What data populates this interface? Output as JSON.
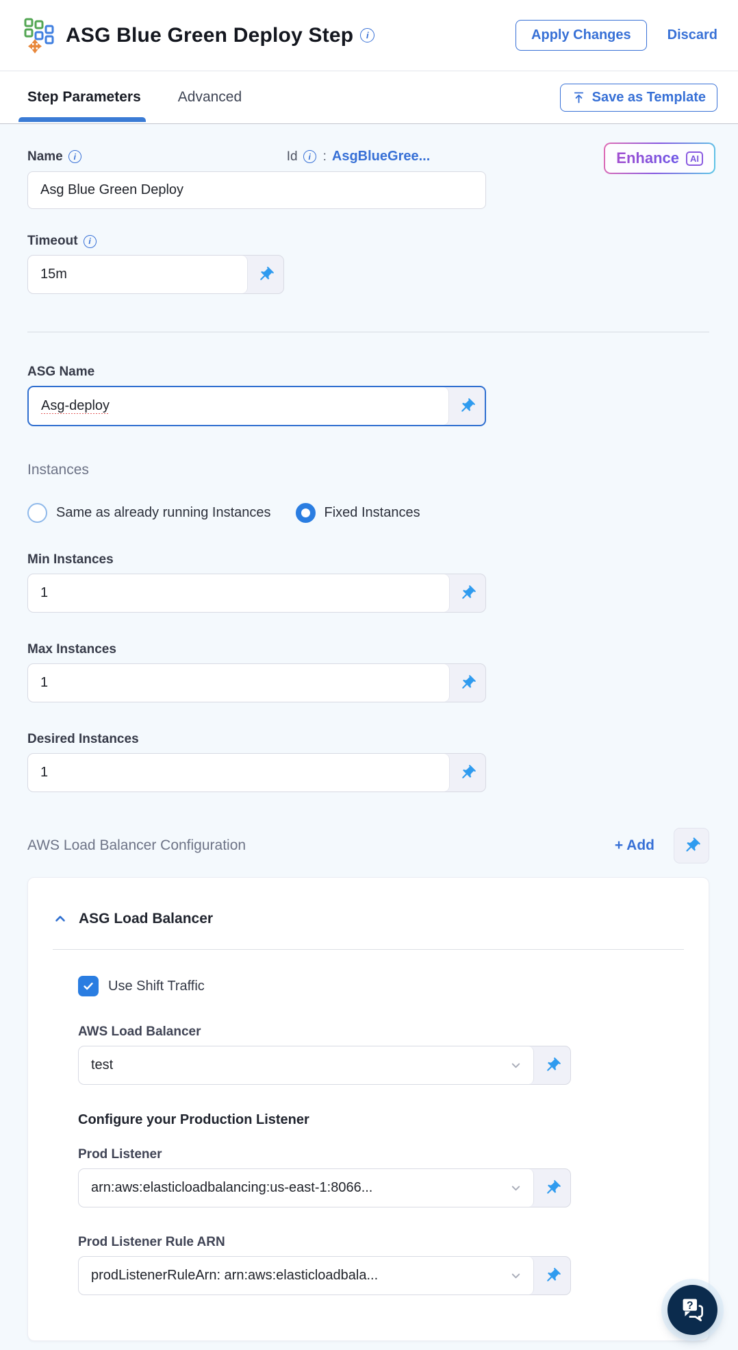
{
  "header": {
    "title": "ASG Blue Green Deploy Step",
    "apply_label": "Apply Changes",
    "discard_label": "Discard"
  },
  "tabs": {
    "step_parameters": "Step Parameters",
    "advanced": "Advanced",
    "save_as_template": "Save as Template"
  },
  "enhance": {
    "label": "Enhance",
    "badge": "AI"
  },
  "form": {
    "name": {
      "label": "Name",
      "value": "Asg Blue Green Deploy"
    },
    "id": {
      "label": "Id",
      "colon": ":",
      "value": "AsgBlueGree..."
    },
    "timeout": {
      "label": "Timeout",
      "value": "15m"
    },
    "asg_name": {
      "label": "ASG Name",
      "value": "Asg-deploy"
    },
    "instances": {
      "label": "Instances",
      "options": [
        {
          "label": "Same as already running Instances",
          "selected": false
        },
        {
          "label": "Fixed Instances",
          "selected": true
        }
      ]
    },
    "min_instances": {
      "label": "Min Instances",
      "value": "1"
    },
    "max_instances": {
      "label": "Max Instances",
      "value": "1"
    },
    "desired_instances": {
      "label": "Desired Instances",
      "value": "1"
    },
    "aws_lb_config": {
      "label": "AWS Load Balancer Configuration",
      "add_label": "+ Add"
    },
    "asg_load_balancer": {
      "title": "ASG Load Balancer",
      "use_shift_traffic": {
        "label": "Use Shift Traffic",
        "checked": true
      },
      "aws_load_balancer": {
        "label": "AWS Load Balancer",
        "value": "test"
      },
      "configure_heading": "Configure your Production Listener",
      "prod_listener": {
        "label": "Prod Listener",
        "value": "arn:aws:elasticloadbalancing:us-east-1:8066..."
      },
      "prod_listener_rule_arn": {
        "label": "Prod Listener Rule ARN",
        "value": "prodListenerRuleArn: arn:aws:elasticloadbala..."
      }
    }
  },
  "colors": {
    "accent_blue": "#3770d6",
    "pin_blue": "#2f9bef",
    "control_blue": "#2a7de1",
    "tab_underline": "#3a7bd5",
    "focus_border": "#2f6fd0",
    "background": "#f4f9fd",
    "chat_navy": "#0b2b4d",
    "enhance_gradient": [
      "#e06db4",
      "#8456e0",
      "#5bc7e6"
    ]
  },
  "icons": {
    "app": "asg-step-icon",
    "info": "info-icon",
    "pin": "pin-icon",
    "upload": "upload-icon",
    "chevron_up": "chevron-up-icon",
    "chevron_down": "chevron-down-icon",
    "chat": "chat-help-icon"
  }
}
